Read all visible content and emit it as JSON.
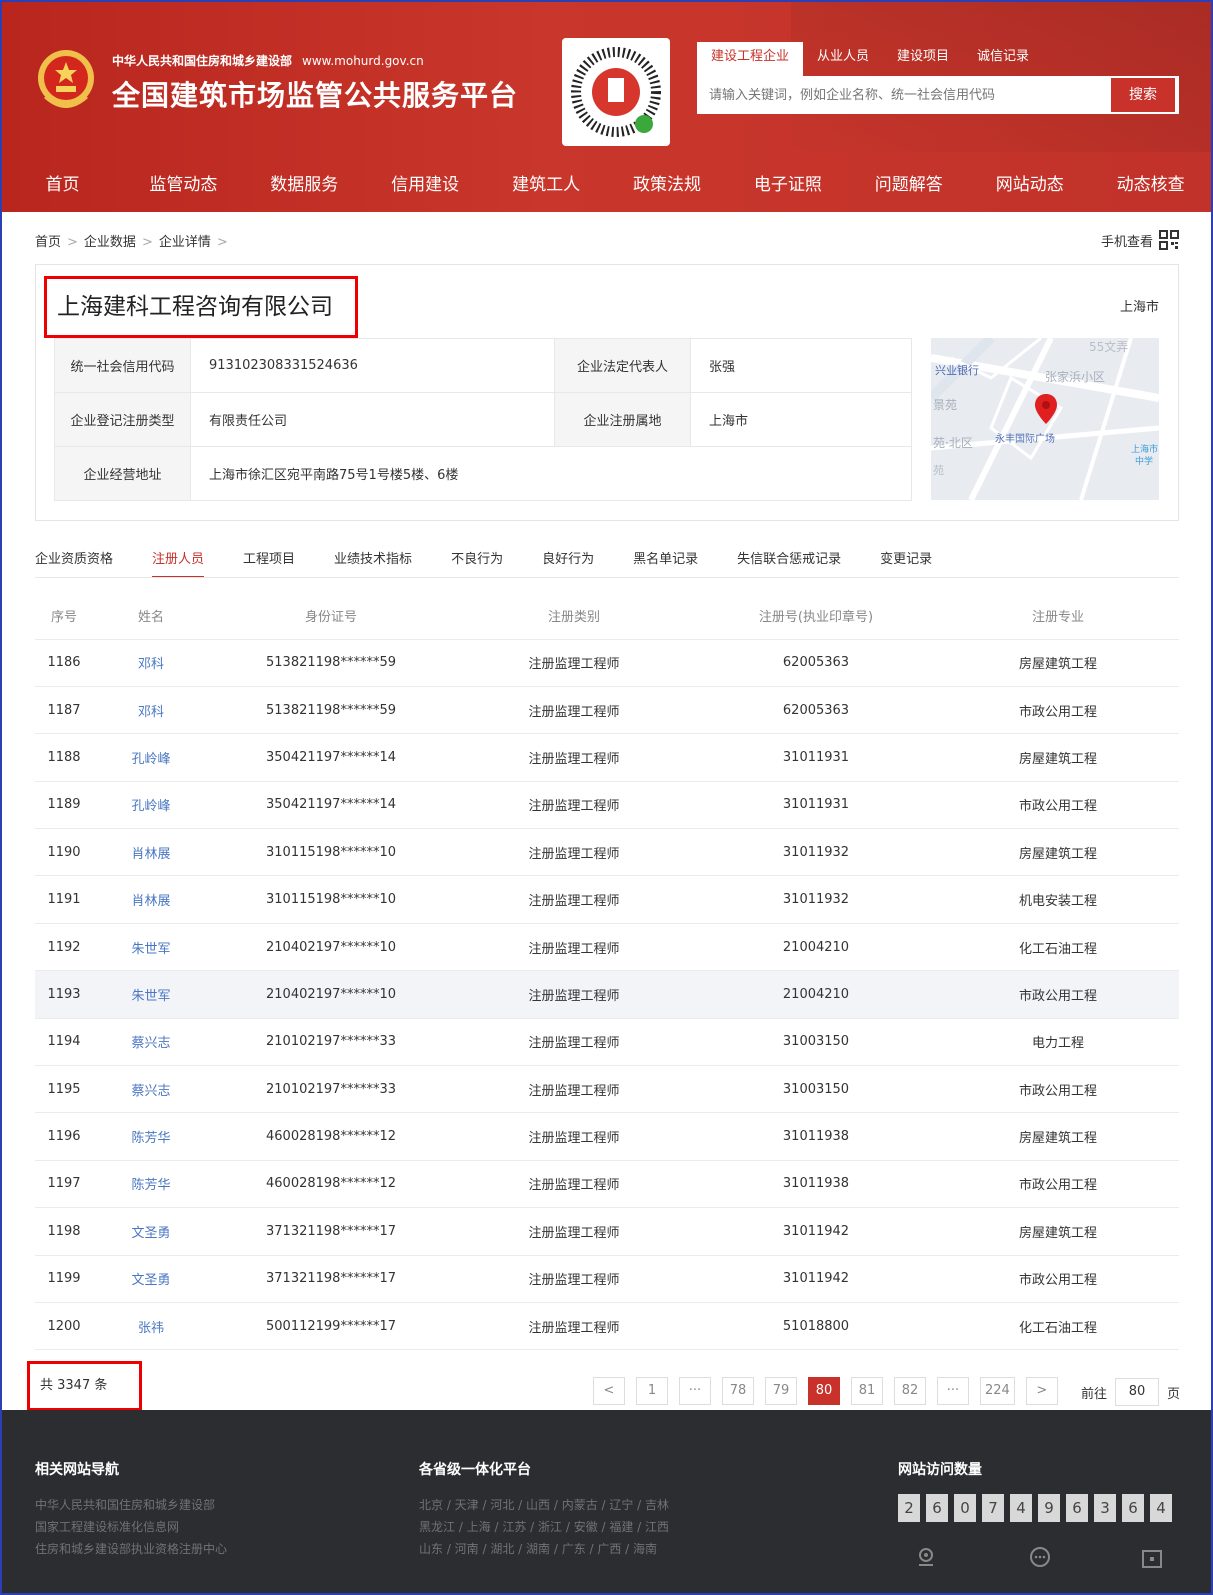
{
  "header": {
    "ministry": "中华人民共和国住房和城乡建设部",
    "url": "www.mohurd.gov.cn",
    "platform": "全国建筑市场监管公共服务平台",
    "search_tabs": [
      "建设工程企业",
      "从业人员",
      "建设项目",
      "诚信记录"
    ],
    "search_placeholder": "请输入关键词，例如企业名称、统一社会信用代码",
    "search_button": "搜索",
    "nav": [
      "首页",
      "监管动态",
      "数据服务",
      "信用建设",
      "建筑工人",
      "政策法规",
      "电子证照",
      "问题解答",
      "网站动态",
      "动态核查"
    ],
    "brand_color": "#c8322a"
  },
  "breadcrumb": [
    "首页",
    "企业数据",
    "企业详情"
  ],
  "mobile_view": "手机查看",
  "company": {
    "name": "上海建科工程咨询有限公司",
    "city": "上海市",
    "credit_code_label": "统一社会信用代码",
    "credit_code": "913102308331524636",
    "legal_rep_label": "企业法定代表人",
    "legal_rep": "张强",
    "reg_type_label": "企业登记注册类型",
    "reg_type": "有限责任公司",
    "reg_place_label": "企业注册属地",
    "reg_place": "上海市",
    "address_label": "企业经营地址",
    "address": "上海市徐汇区宛平南路75号1号楼5楼、6楼"
  },
  "map": {
    "labels": [
      "兴业银行",
      "张家浜小区",
      "55文弄",
      "景苑",
      "苑·北区",
      "永丰国际广场",
      "上海市",
      "中学",
      "苑"
    ]
  },
  "tabs": [
    "企业资质资格",
    "注册人员",
    "工程项目",
    "业绩技术指标",
    "不良行为",
    "良好行为",
    "黑名单记录",
    "失信联合惩戒记录",
    "变更记录"
  ],
  "table": {
    "headers": [
      "序号",
      "姓名",
      "身份证号",
      "注册类别",
      "注册号(执业印章号)",
      "注册专业"
    ],
    "rows": [
      [
        "1186",
        "邓科",
        "513821198******59",
        "注册监理工程师",
        "62005363",
        "房屋建筑工程"
      ],
      [
        "1187",
        "邓科",
        "513821198******59",
        "注册监理工程师",
        "62005363",
        "市政公用工程"
      ],
      [
        "1188",
        "孔岭峰",
        "350421197******14",
        "注册监理工程师",
        "31011931",
        "房屋建筑工程"
      ],
      [
        "1189",
        "孔岭峰",
        "350421197******14",
        "注册监理工程师",
        "31011931",
        "市政公用工程"
      ],
      [
        "1190",
        "肖林展",
        "310115198******10",
        "注册监理工程师",
        "31011932",
        "房屋建筑工程"
      ],
      [
        "1191",
        "肖林展",
        "310115198******10",
        "注册监理工程师",
        "31011932",
        "机电安装工程"
      ],
      [
        "1192",
        "朱世军",
        "210402197******10",
        "注册监理工程师",
        "21004210",
        "化工石油工程"
      ],
      [
        "1193",
        "朱世军",
        "210402197******10",
        "注册监理工程师",
        "21004210",
        "市政公用工程"
      ],
      [
        "1194",
        "蔡兴志",
        "210102197******33",
        "注册监理工程师",
        "31003150",
        "电力工程"
      ],
      [
        "1195",
        "蔡兴志",
        "210102197******33",
        "注册监理工程师",
        "31003150",
        "市政公用工程"
      ],
      [
        "1196",
        "陈芳华",
        "460028198******12",
        "注册监理工程师",
        "31011938",
        "房屋建筑工程"
      ],
      [
        "1197",
        "陈芳华",
        "460028198******12",
        "注册监理工程师",
        "31011938",
        "市政公用工程"
      ],
      [
        "1198",
        "文圣勇",
        "371321198******17",
        "注册监理工程师",
        "31011942",
        "房屋建筑工程"
      ],
      [
        "1199",
        "文圣勇",
        "371321198******17",
        "注册监理工程师",
        "31011942",
        "市政公用工程"
      ],
      [
        "1200",
        "张祎",
        "500112199******17",
        "注册监理工程师",
        "51018800",
        "化工石油工程"
      ]
    ]
  },
  "pagination": {
    "total": "共 3347 条",
    "pages": [
      "<",
      "1",
      "···",
      "78",
      "79",
      "80",
      "81",
      "82",
      "···",
      "224",
      ">"
    ],
    "current": "80",
    "goto_label": "前往",
    "goto_value": "80",
    "page_suffix": "页"
  },
  "footer": {
    "col1_title": "相关网站导航",
    "col1_links": [
      "中华人民共和国住房和城乡建设部",
      "国家工程建设标准化信息网",
      "住房和城乡建设部执业资格注册中心"
    ],
    "col2_title": "各省级一体化平台",
    "col2_lines": [
      "北京 / 天津 / 河北 / 山西 / 内蒙古 / 辽宁 / 吉林",
      "黑龙江 / 上海 / 江苏 / 浙江 / 安徽 / 福建 / 江西",
      "山东 / 河南 / 湖北 / 湖南 / 广东 / 广西 / 海南"
    ],
    "col3_title": "网站访问数量",
    "visit_digits": [
      "2",
      "6",
      "0",
      "7",
      "4",
      "9",
      "6",
      "3",
      "6",
      "4"
    ],
    "icons": [
      "location-icon",
      "chat-icon",
      "qrcode-icon"
    ]
  }
}
